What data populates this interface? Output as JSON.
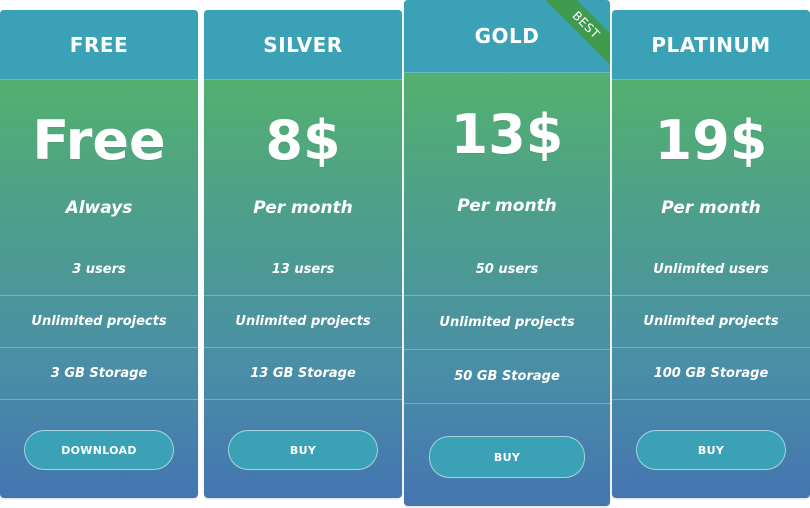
{
  "plans": [
    {
      "name": "FREE",
      "price": "Free",
      "period": "Always",
      "features": [
        "3 users",
        "Unlimited projects",
        "3 GB Storage"
      ],
      "button": "DOWNLOAD"
    },
    {
      "name": "SILVER",
      "price": "8$",
      "period": "Per month",
      "features": [
        "13 users",
        "Unlimited projects",
        "13 GB Storage"
      ],
      "button": "BUY"
    },
    {
      "name": "GOLD",
      "price": "13$",
      "period": "Per month",
      "features": [
        "50 users",
        "Unlimited projects",
        "50 GB Storage"
      ],
      "button": "BUY",
      "ribbon": "BEST"
    },
    {
      "name": "PLATINUM",
      "price": "19$",
      "period": "Per month",
      "features": [
        "Unlimited users",
        "Unlimited projects",
        "100 GB Storage"
      ],
      "button": "BUY"
    }
  ],
  "colors": {
    "header": "#3aa1b7",
    "gradient_top": "#55b960",
    "gradient_bottom": "#4475b0",
    "ribbon": "#3f9a4e",
    "text": "#ffffff"
  }
}
